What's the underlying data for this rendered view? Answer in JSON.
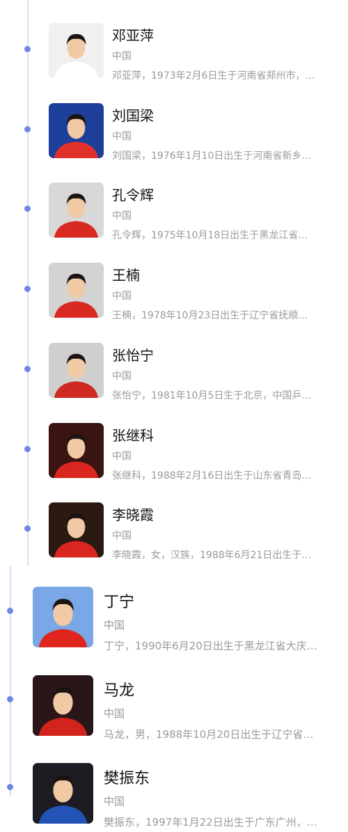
{
  "players_top": [
    {
      "name": "邓亚萍",
      "country": "中国",
      "desc": "邓亚萍，1973年2月6日生于河南省郑州市，…",
      "avatar_icon": "player-photo-icon",
      "shirt": "#ffffff",
      "bg": "#f0f0f0"
    },
    {
      "name": "刘国梁",
      "country": "中国",
      "desc": "刘国梁，1976年1月10日出生于河南省新乡…",
      "avatar_icon": "player-photo-icon",
      "shirt": "#e2302a",
      "bg": "#1d3f9a"
    },
    {
      "name": "孔令辉",
      "country": "中国",
      "desc": "孔令辉，1975年10月18日出生于黑龙江省…",
      "avatar_icon": "player-photo-icon",
      "shirt": "#d92a22",
      "bg": "#d8d8d8"
    },
    {
      "name": "王楠",
      "country": "中国",
      "desc": "王楠，1978年10月23日出生于辽宁省抚顺…",
      "avatar_icon": "player-photo-icon",
      "shirt": "#d92a22",
      "bg": "#d3d3d3"
    },
    {
      "name": "张怡宁",
      "country": "中国",
      "desc": "张怡宁，1981年10月5日生于北京，中国乒…",
      "avatar_icon": "player-photo-icon",
      "shirt": "#cf2a22",
      "bg": "#cfcfcf"
    },
    {
      "name": "张继科",
      "country": "中国",
      "desc": "张继科，1988年2月16日出生于山东省青岛…",
      "avatar_icon": "player-photo-icon",
      "shirt": "#d9261f",
      "bg": "#3a1410"
    },
    {
      "name": "李晓霞",
      "country": "中国",
      "desc": "李晓霞，女，汉族，1988年6月21日出生于…",
      "avatar_icon": "player-photo-icon",
      "shirt": "#d9261f",
      "bg": "#2a1a12"
    }
  ],
  "players_bottom": [
    {
      "name": "丁宁",
      "country": "中国",
      "desc": "丁宁，1990年6月20日出生于黑龙江省大庆…",
      "avatar_icon": "player-photo-icon",
      "shirt": "#e0241e",
      "bg": "#7aa7e6"
    },
    {
      "name": "马龙",
      "country": "中国",
      "desc": "马龙，男，1988年10月20日出生于辽宁省…",
      "avatar_icon": "player-photo-icon",
      "shirt": "#d1241d",
      "bg": "#2a1518"
    },
    {
      "name": "樊振东",
      "country": "中国",
      "desc": "樊振东，1997年1月22日出生于广东广州，…",
      "avatar_icon": "player-photo-icon",
      "shirt": "#2453b8",
      "bg": "#1c1c22"
    }
  ],
  "colors": {
    "accent": "#6f86e6",
    "line": "#d7dbf3",
    "muted": "#9a9a9a"
  }
}
